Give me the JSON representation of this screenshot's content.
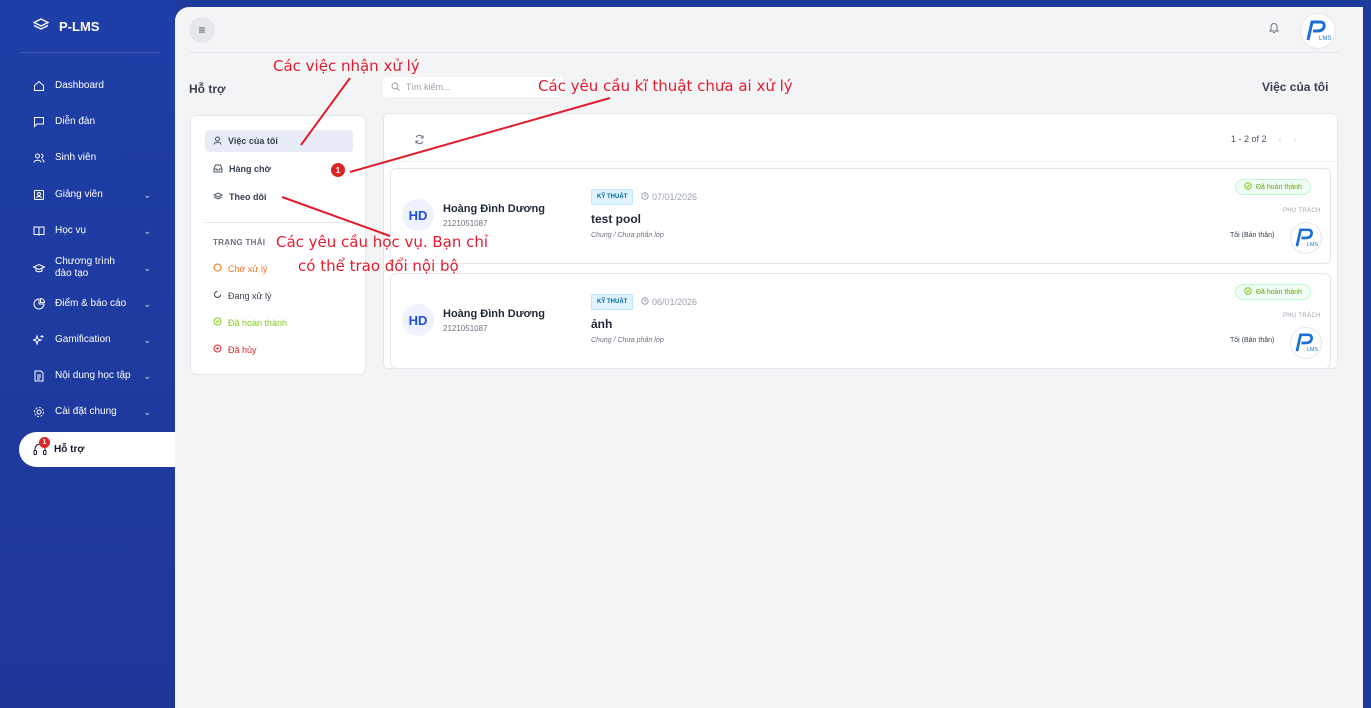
{
  "brand": {
    "name": "P-LMS"
  },
  "sidebar": {
    "items": [
      {
        "label": "Dashboard",
        "icon": "home-icon",
        "has_children": false
      },
      {
        "label": "Diễn đàn",
        "icon": "message-icon",
        "has_children": false
      },
      {
        "label": "Sinh viên",
        "icon": "users-icon",
        "has_children": false
      },
      {
        "label": "Giảng viên",
        "icon": "id-card-icon",
        "has_children": true
      },
      {
        "label": "Học vụ",
        "icon": "book-icon",
        "has_children": true
      },
      {
        "label": "Chương trình đào tạo",
        "icon": "graduation-cap-icon",
        "has_children": true
      },
      {
        "label": "Điểm & báo cáo",
        "icon": "pie-chart-icon",
        "has_children": true
      },
      {
        "label": "Gamification",
        "icon": "sparkle-icon",
        "has_children": true
      },
      {
        "label": "Nội dung học tập",
        "icon": "document-icon",
        "has_children": true
      },
      {
        "label": "Cài đặt chung",
        "icon": "settings-icon",
        "has_children": true
      }
    ],
    "active": {
      "label": "Hỗ trợ",
      "icon": "headset-icon",
      "badge": "1"
    }
  },
  "header": {
    "page_title": "Hỗ trợ",
    "right_title": "Việc của tôi",
    "search_placeholder": "Tìm kiếm..."
  },
  "filters": {
    "items": [
      {
        "label": "Việc của tôi",
        "icon": "user-icon",
        "active": true
      },
      {
        "label": "Hàng chờ",
        "icon": "inbox-icon",
        "badge": "1"
      },
      {
        "label": "Theo dõi",
        "icon": "layers-icon"
      }
    ],
    "status_heading": "TRẠNG THÁI",
    "statuses": [
      {
        "label": "Chờ xử lý",
        "color": "#f97316"
      },
      {
        "label": "Đang xử lý",
        "color": "#374151"
      },
      {
        "label": "Đã hoàn thành",
        "color": "#84cc16"
      },
      {
        "label": "Đã hủy",
        "color": "#dc2626"
      }
    ]
  },
  "list": {
    "pager": "1 - 2 of 2",
    "tickets": [
      {
        "initials": "HD",
        "name": "Hoàng Đình Dương",
        "student_id": "2121051087",
        "tag": "KỸ THUẬT",
        "date": "07/01/2026",
        "title": "test pool",
        "subtitle": "Chung / Chưa phân lớp",
        "status": "Đã hoàn thành",
        "assignee_label": "PHỤ TRÁCH",
        "assignee": "Tôi (Bản thân)"
      },
      {
        "initials": "HD",
        "name": "Hoàng Đình Dương",
        "student_id": "2121051087",
        "tag": "KỸ THUẬT",
        "date": "06/01/2026",
        "title": "ảnh",
        "subtitle": "Chung / Chưa phân lớp",
        "status": "Đã hoàn thành",
        "assignee_label": "PHỤ TRÁCH",
        "assignee": "Tôi (Bản thân)"
      }
    ]
  },
  "annotations": {
    "a1": "Các việc nhận xử lý",
    "a2": "Các yêu cầu kĩ thuật chưa ai xử lý",
    "a3_line1": "Các yêu cầu học vụ. Bạn chỉ",
    "a3_line2": "có thể trao đổi nội bộ"
  },
  "colors": {
    "sidebar": "#1f3fa8",
    "accent": "#1d4ed8",
    "annotation": "#e11d2e",
    "badge": "#dc2626"
  }
}
